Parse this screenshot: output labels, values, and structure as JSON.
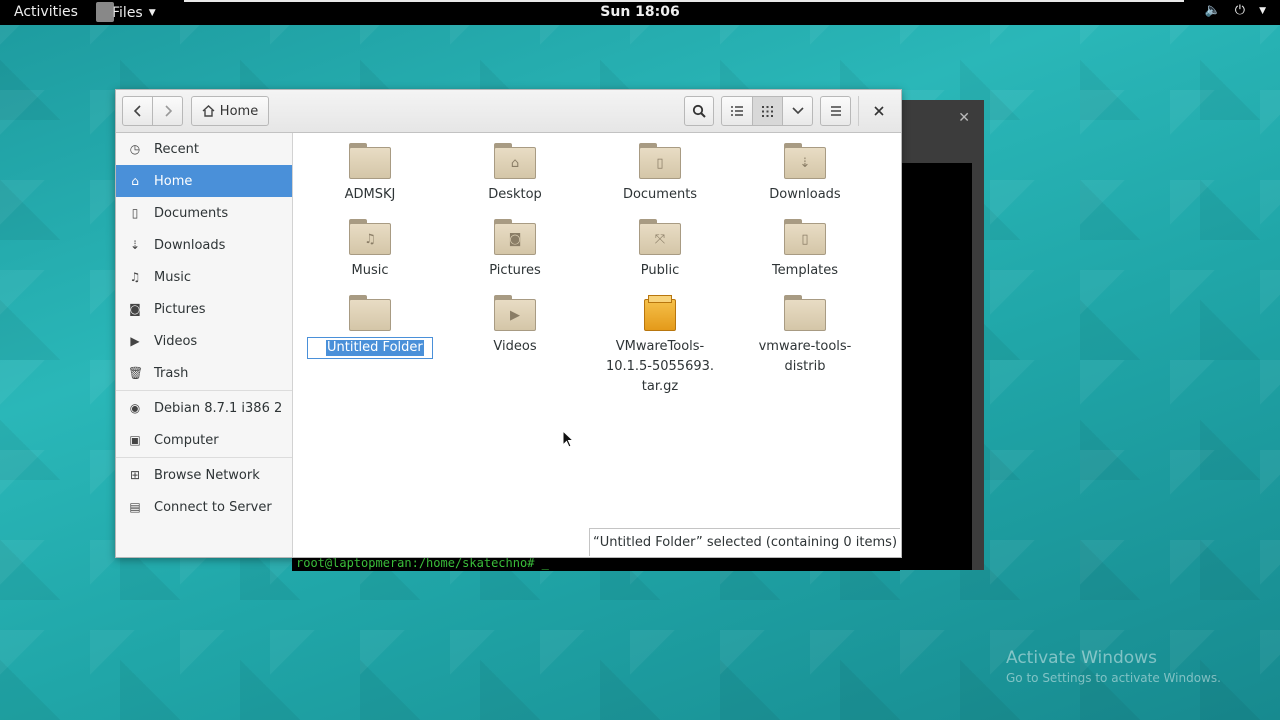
{
  "topbar": {
    "activities": "Activities",
    "app_menu": "Files",
    "clock": "Sun 18:06"
  },
  "terminal": {
    "prompt": "root@laptopmeran:/home/skatechno# _"
  },
  "files": {
    "home_label": "Home",
    "sidebar": [
      {
        "label": "Recent",
        "icon": "clock-icon"
      },
      {
        "label": "Home",
        "icon": "home-icon",
        "active": true
      },
      {
        "label": "Documents",
        "icon": "document-icon"
      },
      {
        "label": "Downloads",
        "icon": "download-icon"
      },
      {
        "label": "Music",
        "icon": "music-icon"
      },
      {
        "label": "Pictures",
        "icon": "camera-icon"
      },
      {
        "label": "Videos",
        "icon": "video-icon"
      },
      {
        "label": "Trash",
        "icon": "trash-icon"
      },
      {
        "label": "Debian 8.7.1 i386 2",
        "icon": "disc-icon"
      },
      {
        "label": "Computer",
        "icon": "computer-icon"
      },
      {
        "label": "Browse Network",
        "icon": "network-icon"
      },
      {
        "label": "Connect to Server",
        "icon": "server-icon"
      }
    ],
    "items": [
      {
        "label": "ADMSKJ",
        "icon": "folder-icon"
      },
      {
        "label": "Desktop",
        "icon": "folder-desktop-icon"
      },
      {
        "label": "Documents",
        "icon": "folder-documents-icon"
      },
      {
        "label": "Downloads",
        "icon": "folder-downloads-icon"
      },
      {
        "label": "Music",
        "icon": "folder-music-icon"
      },
      {
        "label": "Pictures",
        "icon": "folder-pictures-icon"
      },
      {
        "label": "Public",
        "icon": "folder-public-icon"
      },
      {
        "label": "Templates",
        "icon": "folder-templates-icon"
      },
      {
        "label": "Untitled Folder",
        "icon": "folder-icon",
        "renaming": true
      },
      {
        "label": "Videos",
        "icon": "folder-videos-icon"
      },
      {
        "label_lines": [
          "VMwareTools-",
          "10.1.5-5055693.",
          "tar.gz"
        ],
        "icon": "archive-icon"
      },
      {
        "label_lines": [
          "vmware-tools-",
          "distrib"
        ],
        "icon": "folder-icon"
      }
    ],
    "status": "“Untitled Folder” selected  (containing 0 items)"
  },
  "watermark": {
    "line1": "Activate Windows",
    "line2": "Go to Settings to activate Windows."
  }
}
